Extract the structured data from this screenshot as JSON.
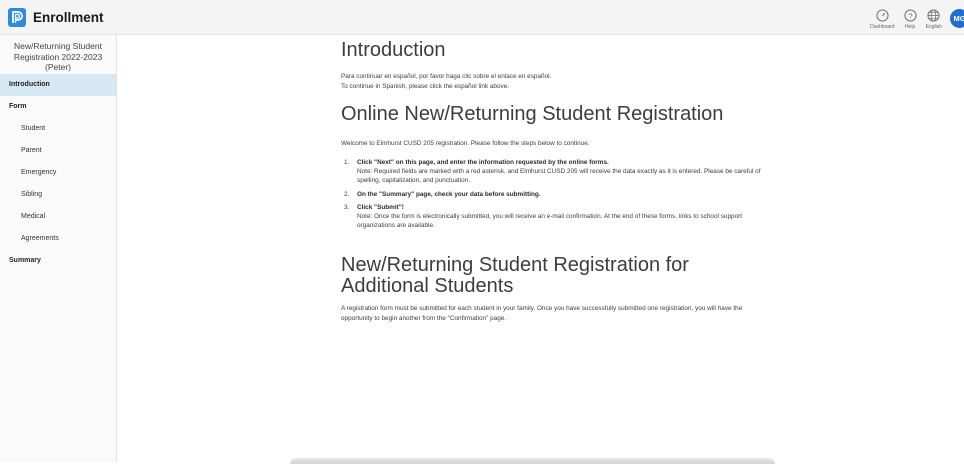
{
  "app": {
    "title": "Enrollment"
  },
  "topbar": {
    "dashboard_label": "Dashboard",
    "help_label": "Help",
    "language_label": "English",
    "avatar_initials": "MG",
    "accent_color": "#1e6ed6"
  },
  "sidebar": {
    "registration_title": "New/Returning Student Registration 2022-2023 (Peter)",
    "items": [
      {
        "label": "Introduction",
        "active": true
      },
      {
        "label": "Form"
      },
      {
        "label": "Student"
      },
      {
        "label": "Parent"
      },
      {
        "label": "Emergency"
      },
      {
        "label": "Sibling"
      },
      {
        "label": "Medical"
      },
      {
        "label": "Agreements"
      },
      {
        "label": "Summary"
      }
    ]
  },
  "main": {
    "intro_heading": "Introduction",
    "intro_line1": "Para continuar en español, por favor haga clic sobre el enlace en español.",
    "intro_line2": "To continue in Spanish, please click the español link above.",
    "online_heading": "Online New/Returning Student Registration",
    "welcome": "Welcome to Elmhurst CUSD 205 registration. Please follow the steps below to continue.",
    "steps": [
      {
        "num": "1.",
        "lead": "Click \"Next\" on this page, and enter the information requested by the online forms.",
        "note": "Note: Required fields are marked with a red asterisk, and Elmhurst CUSD 205 will receive the data exactly as it is entered.  Please be careful of spelling, capitalization, and punctuation."
      },
      {
        "num": "2.",
        "lead": "On the \"Summary\" page, check your data before submitting."
      },
      {
        "num": "3.",
        "lead": "Click \"Submit\"!",
        "note": "Note:  Once the form is electronically submitted, you will receive an e-mail confirmation. At the end of these forms, links to school support organizations are available."
      }
    ],
    "additional_heading": "New/Returning Student Registration for Additional Students",
    "additional_text": "A registration form must be submitted for each student in your family. Once you have successfully submitted one registration, you will have the opportunity to begin another from the \"Confirmation\" page."
  }
}
